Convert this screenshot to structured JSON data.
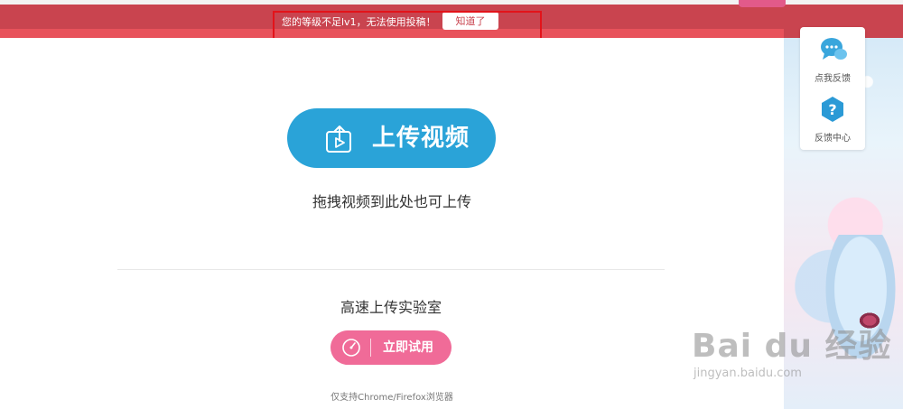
{
  "notice": {
    "message": "您的等级不足lv1，无法使用投稿！",
    "dismiss_label": "知道了"
  },
  "upload": {
    "button_label": "上传视频",
    "drag_hint": "拖拽视频到此处也可上传"
  },
  "lab": {
    "title": "高速上传实验室",
    "try_label": "立即试用",
    "support_note": "仅支持Chrome/Firefox浏览器"
  },
  "side": {
    "items": [
      {
        "label": "点我反馈",
        "icon": "chat-bubbles-icon"
      },
      {
        "label": "反馈中心",
        "icon": "question-icon"
      }
    ]
  },
  "watermark": {
    "logo": "Bai du 经验",
    "url": "jingyan.baidu.com"
  },
  "colors": {
    "banner": "#c9444f",
    "upload_button": "#2aa3d8",
    "try_button": "#f06b98",
    "highlight_box": "#e3131a"
  }
}
